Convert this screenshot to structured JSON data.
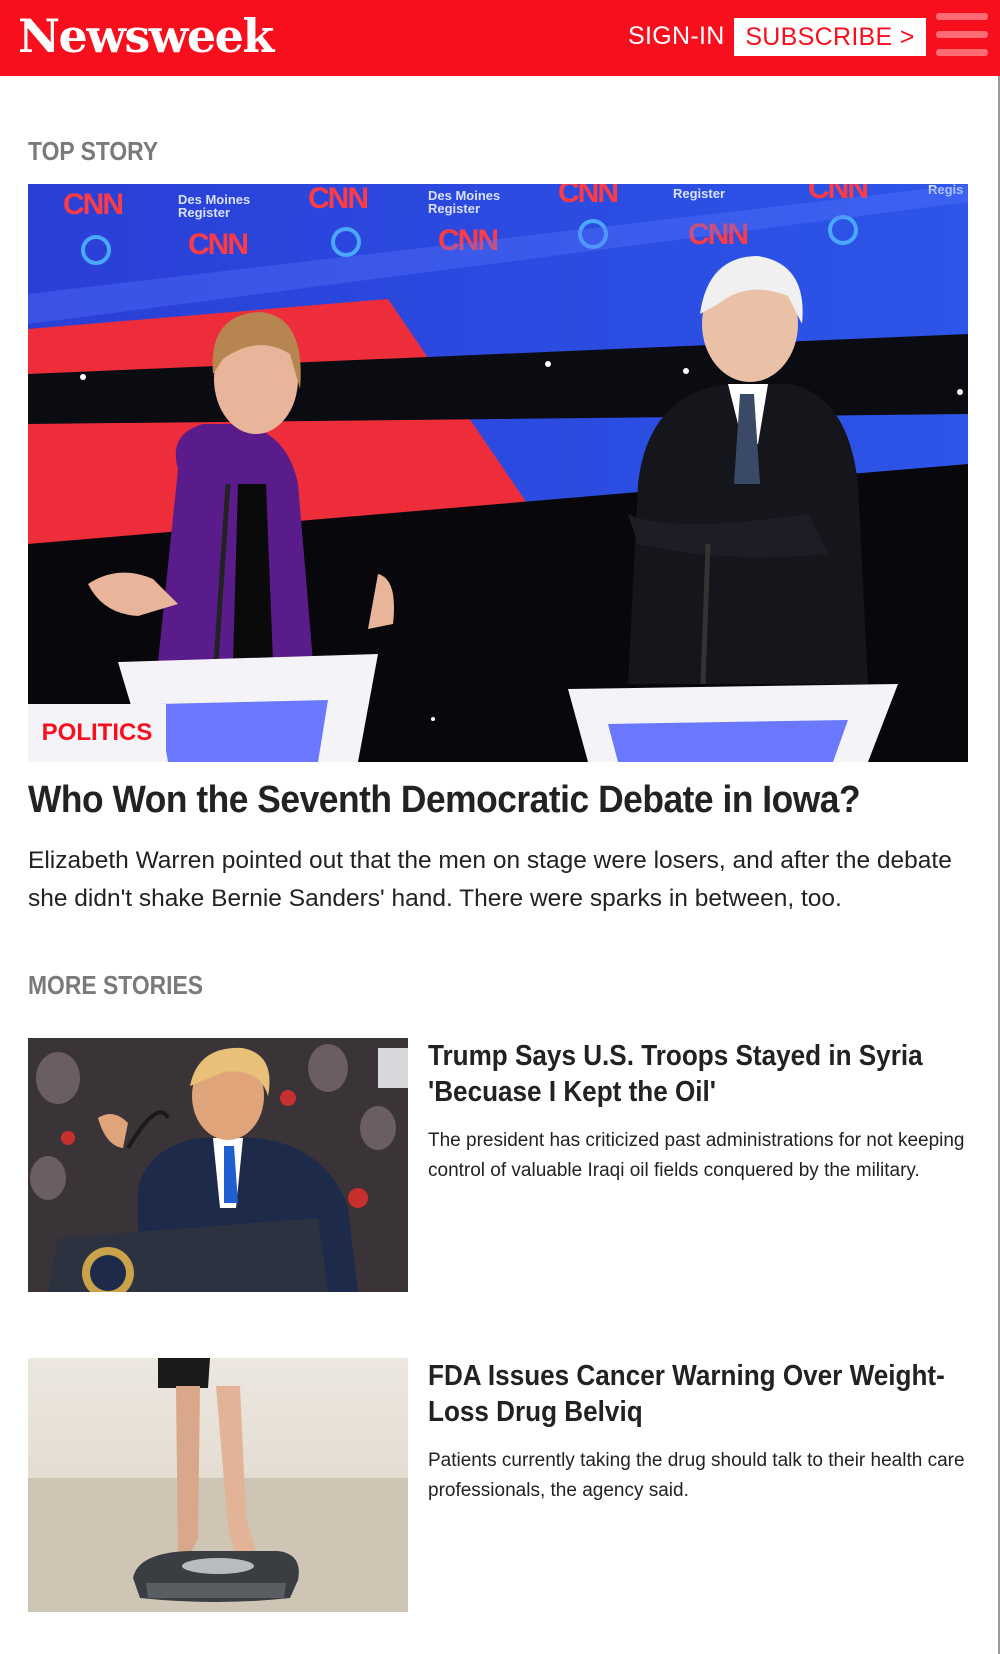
{
  "header": {
    "logo": "Newsweek",
    "signin_label": "SIGN-IN",
    "subscribe_label": "SUBSCRIBE >",
    "menu_icon": "hamburger-menu-icon",
    "brand_color": "#f70f1e"
  },
  "top_story": {
    "section_label": "TOP STORY",
    "category": "POLITICS",
    "title": "Who Won the Seventh Democratic Debate in Iowa?",
    "summary": "Elizabeth Warren pointed out that the men on stage were losers, and after the debate she didn't shake Bernie Sanders' hand. There were sparks in between, too.",
    "image_backdrop_logos": [
      "CNN",
      "Des Moines Register"
    ]
  },
  "more_stories": {
    "section_label": "MORE STORIES",
    "items": [
      {
        "title": "Trump Says U.S. Troops Stayed in Syria 'Becuase I Kept the Oil'",
        "summary": "The president has criticized past administrations for not keeping control of valuable Iraqi oil fields conquered by the military."
      },
      {
        "title": "FDA Issues Cancer Warning Over Weight-Loss Drug Belviq",
        "summary": "Patients currently taking the drug should talk to their health care professionals, the agency said."
      }
    ]
  }
}
